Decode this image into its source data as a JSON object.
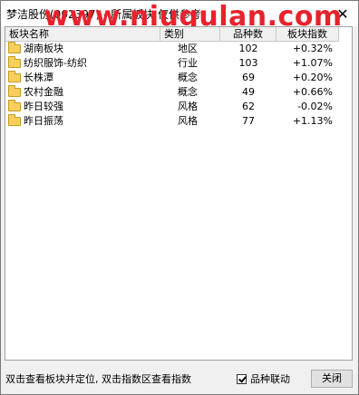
{
  "window": {
    "title": "梦洁股份(002397) - 所属板块 仅供参考",
    "close_glyph": "✕"
  },
  "watermark": "www.niugulan.com",
  "table": {
    "headers": [
      "板块名称",
      "类别",
      "品种数",
      "板块指数"
    ],
    "rows": [
      {
        "name": "湖南板块",
        "type": "地区",
        "count": "102",
        "change": "+0.32%"
      },
      {
        "name": "纺织服饰-纺织",
        "type": "行业",
        "count": "103",
        "change": "+1.07%"
      },
      {
        "name": "长株潭",
        "type": "概念",
        "count": "69",
        "change": "+0.20%"
      },
      {
        "name": "农村金融",
        "type": "概念",
        "count": "49",
        "change": "+0.66%"
      },
      {
        "name": "昨日较强",
        "type": "风格",
        "count": "62",
        "change": "-0.02%"
      },
      {
        "name": "昨日振荡",
        "type": "风格",
        "count": "77",
        "change": "+1.13%"
      }
    ]
  },
  "footer": {
    "hint": "双击查看板块并定位, 双击指数区查看指数",
    "checkbox_label": "品种联动",
    "checkbox_checked": true,
    "close_label": "关闭"
  }
}
